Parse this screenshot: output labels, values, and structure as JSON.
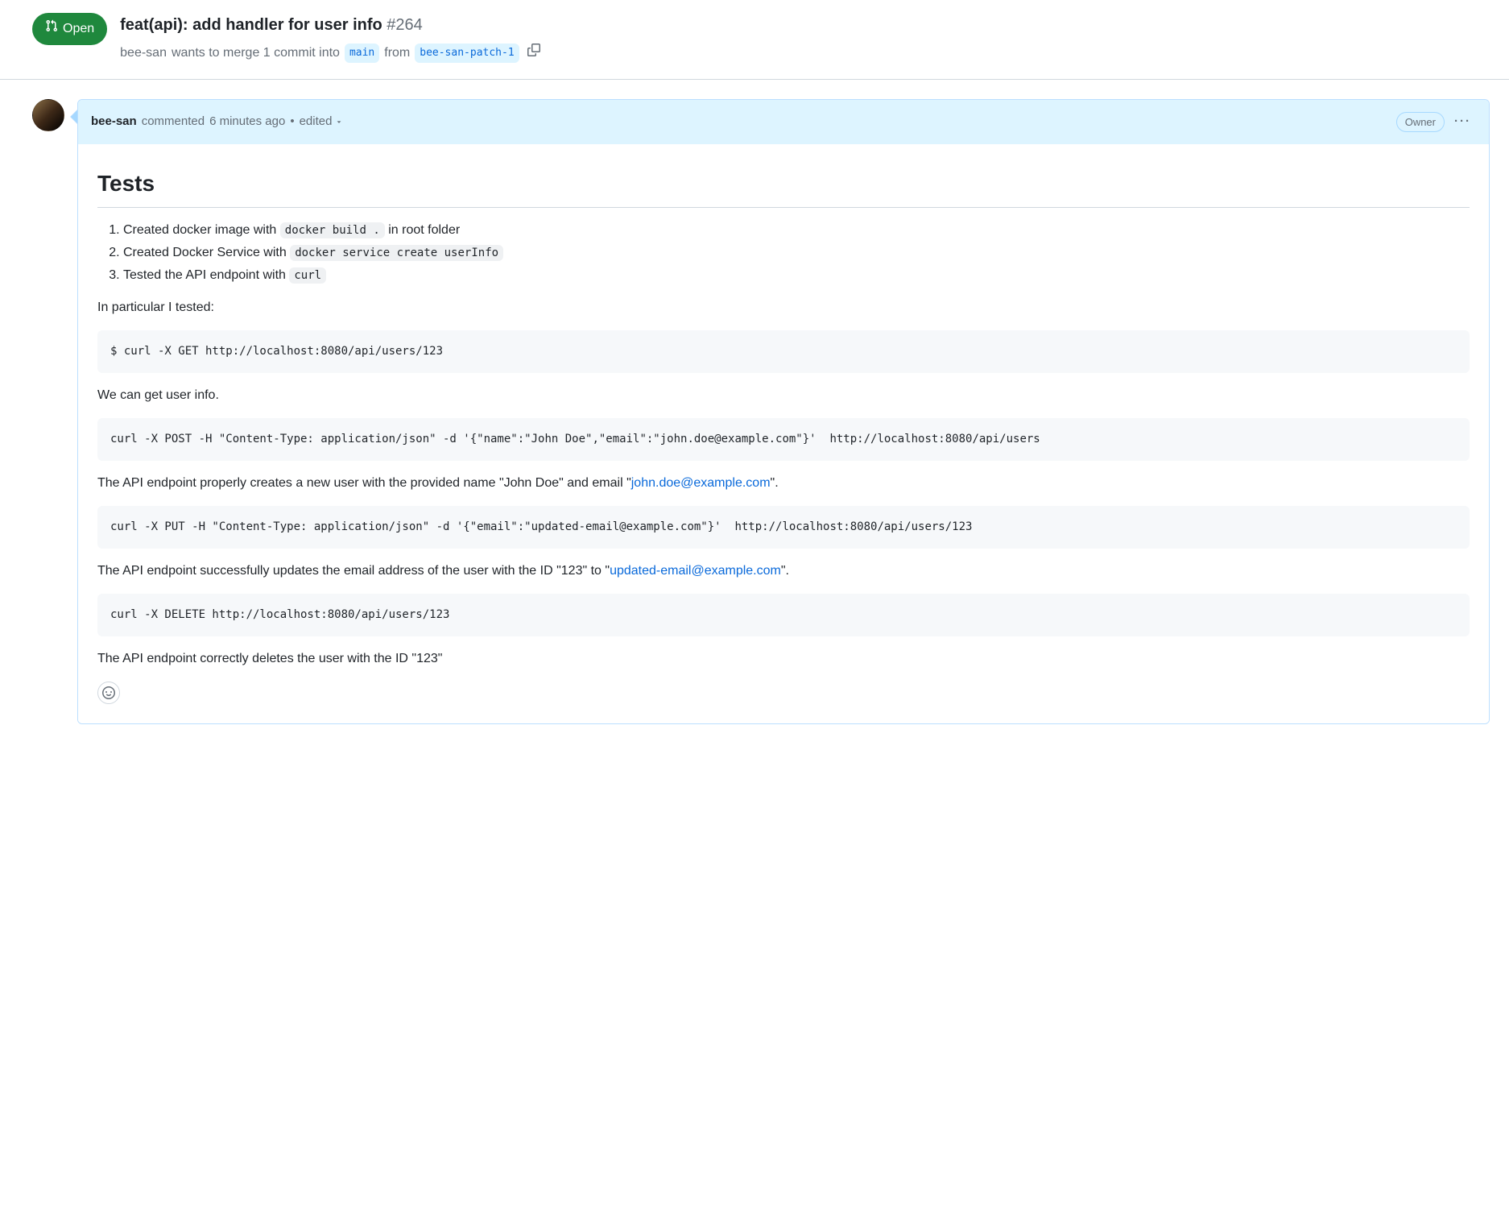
{
  "header": {
    "state": "Open",
    "title": "feat(api): add handler for user info",
    "pr_number": "#264",
    "author": "bee-san",
    "merge_text_1": "wants to merge 1 commit into",
    "base_branch": "main",
    "merge_text_2": "from",
    "head_branch": "bee-san-patch-1"
  },
  "comment": {
    "author": "bee-san",
    "commented_text": "commented",
    "timestamp": "6 minutes ago",
    "bullet": "•",
    "edited_label": "edited",
    "owner_label": "Owner",
    "heading": "Tests",
    "list_items": [
      {
        "prefix": "Created docker image with ",
        "code": "docker build .",
        "suffix": " in root folder"
      },
      {
        "prefix": "Created Docker Service with ",
        "code": "docker service create userInfo",
        "suffix": ""
      },
      {
        "prefix": "Tested the API endpoint with ",
        "code": "curl",
        "suffix": ""
      }
    ],
    "p_intro": "In particular I tested:",
    "code1": "$ curl -X GET http://localhost:8080/api/users/123",
    "p_get": "We can get user info.",
    "code2": "curl -X POST -H \"Content-Type: application/json\" -d '{\"name\":\"John Doe\",\"email\":\"john.doe@example.com\"}'  http://localhost:8080/api/users",
    "p_post_prefix": "The API endpoint properly creates a new user with the provided name \"John Doe\" and email \"",
    "p_post_link": "john.doe@example.com",
    "p_post_suffix": "\".",
    "code3": "curl -X PUT -H \"Content-Type: application/json\" -d '{\"email\":\"updated-email@example.com\"}'  http://localhost:8080/api/users/123",
    "p_put_prefix": "The API endpoint successfully updates the email address of the user with the ID \"123\" to \"",
    "p_put_link": "updated-email@example.com",
    "p_put_suffix": "\".",
    "code4": "curl -X DELETE http://localhost:8080/api/users/123",
    "p_delete": "The API endpoint correctly deletes the user with the ID \"123\""
  }
}
